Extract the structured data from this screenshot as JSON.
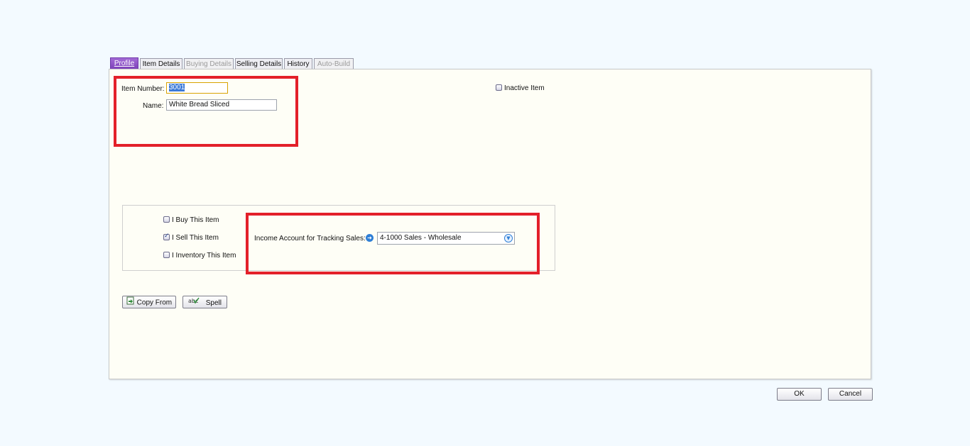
{
  "tabs": [
    {
      "label": "Profile",
      "state": "active"
    },
    {
      "label": "Item Details",
      "state": "normal"
    },
    {
      "label": "Buying Details",
      "state": "disabled"
    },
    {
      "label": "Selling Details",
      "state": "normal"
    },
    {
      "label": "History",
      "state": "normal"
    },
    {
      "label": "Auto-Build",
      "state": "disabled"
    }
  ],
  "profile": {
    "item_number_label": "Item Number:",
    "item_number_value": "3001",
    "name_label": "Name:",
    "name_value": "White Bread Sliced",
    "inactive_label": "Inactive Item",
    "inactive_checked": false
  },
  "options": {
    "buy_label": "I Buy This Item",
    "buy_checked": false,
    "sell_label": "I Sell This Item",
    "sell_checked": true,
    "inventory_label": "I Inventory This Item",
    "inventory_checked": false,
    "income_account_label": "Income Account for Tracking Sales:",
    "income_account_value": "4-1000 Sales - Wholesale"
  },
  "buttons": {
    "copy_from": "Copy From",
    "spell": "Spell",
    "ok": "OK",
    "cancel": "Cancel"
  },
  "icons": {
    "link_arrow": "arrow-right-circle-icon",
    "dropdown": "chevron-down-circle-icon",
    "copy": "copy-icon",
    "spell": "spellcheck-icon"
  },
  "colors": {
    "highlight_box": "#e3202a",
    "active_tab": "#7b3fb8",
    "panel_bg": "#fefef6",
    "page_bg": "#f3faff"
  }
}
